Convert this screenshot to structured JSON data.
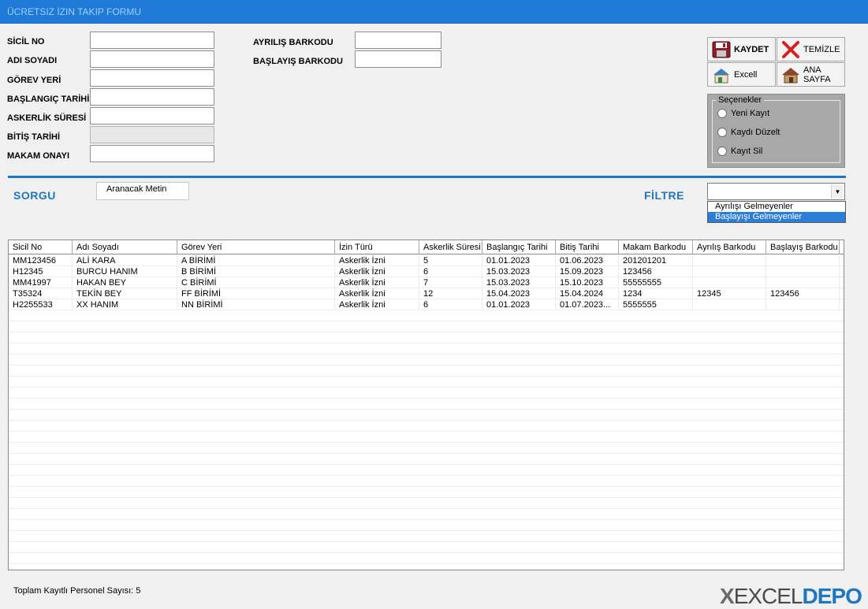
{
  "window": {
    "title": "ÜCRETSIZ İZIN TAKIP FORMU"
  },
  "form": {
    "sicil_no": {
      "label": "SİCİL NO",
      "value": ""
    },
    "adi_soyadi": {
      "label": "ADI SOYADI",
      "value": ""
    },
    "gorev_yeri": {
      "label": "GÖREV YERİ",
      "value": ""
    },
    "baslangic_tarihi": {
      "label": "BAŞLANGIÇ TARİHİ",
      "value": ""
    },
    "askerlik_suresi": {
      "label": "ASKERLİK SÜRESİ",
      "value": ""
    },
    "bitis_tarihi": {
      "label": "BİTİŞ TARİHİ",
      "value": ""
    },
    "makam_onayi": {
      "label": "MAKAM ONAYI",
      "value": ""
    },
    "ayrilis_barkodu": {
      "label": "AYRILIŞ BARKODU",
      "value": ""
    },
    "baslayis_barkodu": {
      "label": "BAŞLAYIŞ BARKODU",
      "value": ""
    }
  },
  "buttons": {
    "kaydet": "KAYDET",
    "temizle": "TEMİZLE",
    "excell": "Excell",
    "ana_sayfa": "ANA SAYFA"
  },
  "options": {
    "caption": "Seçenekler",
    "items": [
      "Yeni Kayıt",
      "Kaydı Düzelt",
      "Kayıt Sil"
    ]
  },
  "query": {
    "sorgu_label": "SORGU",
    "search_text": "Aranacak Metin",
    "filtre_label": "FİLTRE",
    "filter_value": "",
    "filter_options": [
      "Ayrılışı Gelmeyenler",
      "Başlayışı Gelmeyenler"
    ],
    "filter_selected_index": 1
  },
  "grid": {
    "columns": [
      "Sicil No",
      "Adı Soyadı",
      "Görev Yeri",
      "İzin Türü",
      "Askerlik Süresi",
      "Başlangıç Tarihi",
      "Bitiş Tarihi",
      "Makam Barkodu",
      "Ayrılış Barkodu",
      "Başlayış Barkodu"
    ],
    "rows": [
      [
        "MM123456",
        "ALİ KARA",
        "A BİRİMİ",
        "Askerlik İzni",
        "5",
        "01.01.2023",
        "01.06.2023",
        "201201201",
        "",
        ""
      ],
      [
        "H12345",
        "BURCU HANIM",
        "B BİRİMİ",
        "Askerlik İzni",
        "6",
        "15.03.2023",
        "15.09.2023",
        "123456",
        "",
        ""
      ],
      [
        "MM41997",
        "HAKAN BEY",
        "C BİRİMİ",
        "Askerlik İzni",
        "7",
        "15.03.2023",
        "15.10.2023",
        "55555555",
        "",
        ""
      ],
      [
        "T35324",
        "TEKİN BEY",
        "FF BİRİMİ",
        "Askerlik İzni",
        "12",
        "15.04.2023",
        "15.04.2024",
        "1234",
        "12345",
        "123456"
      ],
      [
        "H2255533",
        "XX HANIM",
        "NN BİRİMİ",
        "Askerlik İzni",
        "6",
        "01.01.2023",
        "01.07.2023...",
        "5555555",
        "",
        ""
      ]
    ]
  },
  "status": {
    "text": "Toplam Kayıtlı Personel Sayısı: 5"
  },
  "logo": {
    "prefix": "X",
    "excel": "EXCEL",
    "depo": "DEPO"
  },
  "colors": {
    "accent": "#1f77c2",
    "titlebar": "#1e7ad6",
    "selection": "#2a7ed8"
  }
}
